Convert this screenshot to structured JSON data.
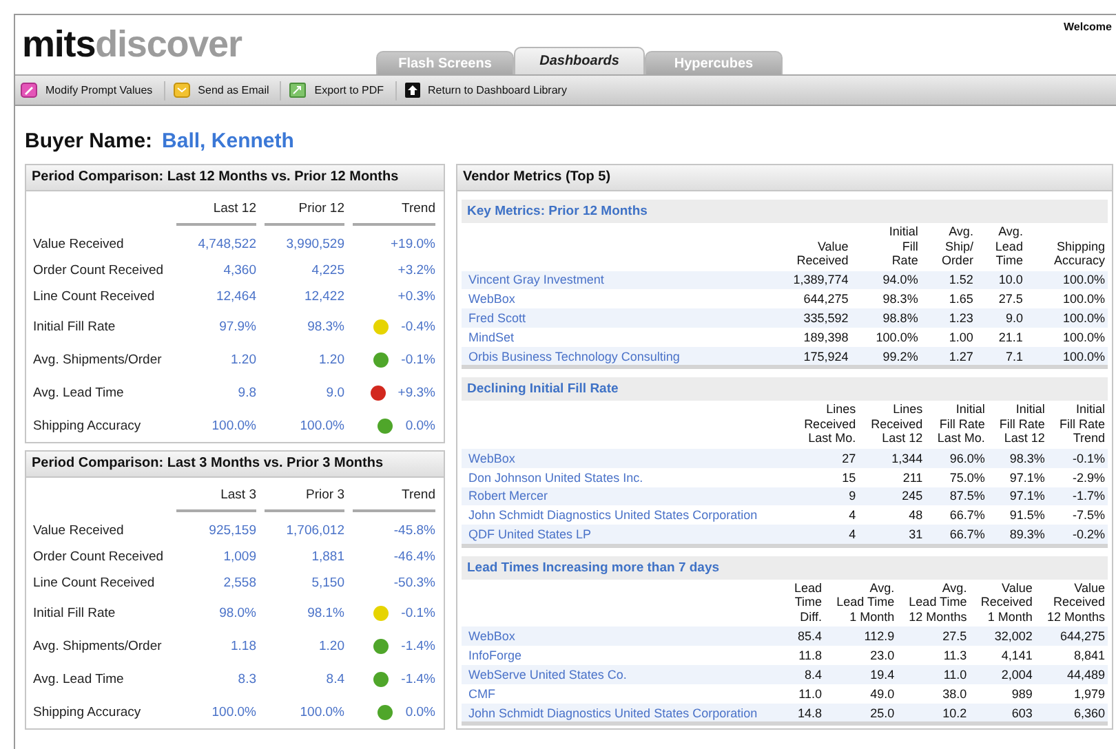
{
  "header": {
    "logo_dark": "mits",
    "logo_light": "discover",
    "welcome": "Welcome"
  },
  "tabs": [
    {
      "label": "Flash Screens",
      "selected": false
    },
    {
      "label": "Dashboards",
      "selected": true
    },
    {
      "label": "Hypercubes",
      "selected": false
    }
  ],
  "toolbar": [
    {
      "label": "Modify Prompt Values",
      "kind": "edit"
    },
    {
      "label": "Send as Email",
      "kind": "email"
    },
    {
      "label": "Export to PDF",
      "kind": "export"
    },
    {
      "label": "Return to Dashboard Library",
      "kind": "up"
    }
  ],
  "buyer": {
    "label": "Buyer Name:",
    "name": "Ball, Kenneth"
  },
  "period_panels": [
    {
      "title": "Period Comparison: Last 12 Months vs. Prior 12 Months",
      "columns": [
        "Last 12",
        "Prior 12",
        "Trend"
      ],
      "rows": [
        {
          "label": "Value Received",
          "current": "4,748,522",
          "prior": "3,990,529",
          "trend": "+19.0%"
        },
        {
          "label": "Order Count Received",
          "current": "4,360",
          "prior": "4,225",
          "trend": "+3.2%"
        },
        {
          "label": "Line Count Received",
          "current": "12,464",
          "prior": "12,422",
          "trend": "+0.3%"
        },
        {
          "label": "Initial Fill Rate",
          "current": "97.9%",
          "prior": "98.3%",
          "trend": "-0.4%",
          "color": "#e6d400"
        },
        {
          "label": "Avg. Shipments/Order",
          "current": "1.20",
          "prior": "1.20",
          "trend": "-0.1%",
          "color": "#4fa62a"
        },
        {
          "label": "Avg. Lead Time",
          "current": "9.8",
          "prior": "9.0",
          "trend": "+9.3%",
          "color": "#d2281e"
        },
        {
          "label": "Shipping Accuracy",
          "current": "100.0%",
          "prior": "100.0%",
          "trend": "0.0%",
          "color": "#4fa62a"
        }
      ]
    },
    {
      "title": "Period Comparison: Last 3 Months vs. Prior 3 Months",
      "columns": [
        "Last 3",
        "Prior 3",
        "Trend"
      ],
      "rows": [
        {
          "label": "Value Received",
          "current": "925,159",
          "prior": "1,706,012",
          "trend": "-45.8%"
        },
        {
          "label": "Order Count Received",
          "current": "1,009",
          "prior": "1,881",
          "trend": "-46.4%"
        },
        {
          "label": "Line Count Received",
          "current": "2,558",
          "prior": "5,150",
          "trend": "-50.3%"
        },
        {
          "label": "Initial Fill Rate",
          "current": "98.0%",
          "prior": "98.1%",
          "trend": "-0.1%",
          "color": "#e6d400"
        },
        {
          "label": "Avg. Shipments/Order",
          "current": "1.18",
          "prior": "1.20",
          "trend": "-1.4%",
          "color": "#4fa62a"
        },
        {
          "label": "Avg. Lead Time",
          "current": "8.3",
          "prior": "8.4",
          "trend": "-1.4%",
          "color": "#4fa62a"
        },
        {
          "label": "Shipping Accuracy",
          "current": "100.0%",
          "prior": "100.0%",
          "trend": "0.0%",
          "color": "#4fa62a"
        }
      ]
    }
  ],
  "vendor_panel": {
    "title": "Vendor Metrics (Top 5)",
    "sections": [
      {
        "title": "Key Metrics: Prior 12 Months",
        "columns": [
          "Value\nReceived",
          "Initial\nFill\nRate",
          "Avg.\nShip/\nOrder",
          "Avg.\nLead\nTime",
          "Shipping\nAccuracy"
        ],
        "rows": [
          {
            "name": "Vincent Gray Investment",
            "values": [
              "1,389,774",
              "94.0%",
              "1.52",
              "10.0",
              "100.0%"
            ]
          },
          {
            "name": "WebBox",
            "values": [
              "644,275",
              "98.3%",
              "1.65",
              "27.5",
              "100.0%"
            ]
          },
          {
            "name": "Fred Scott",
            "values": [
              "335,592",
              "98.8%",
              "1.23",
              "9.0",
              "100.0%"
            ]
          },
          {
            "name": "MindSet",
            "values": [
              "189,398",
              "100.0%",
              "1.00",
              "21.1",
              "100.0%"
            ]
          },
          {
            "name": "Orbis Business Technology Consulting",
            "values": [
              "175,924",
              "99.2%",
              "1.27",
              "7.1",
              "100.0%"
            ]
          }
        ]
      },
      {
        "title": "Declining Initial Fill Rate",
        "columns": [
          "Lines\nReceived\nLast Mo.",
          "Lines\nReceived\nLast 12",
          "Initial\nFill Rate\nLast Mo.",
          "Initial\nFill Rate\nLast 12",
          "Initial\nFill Rate\nTrend"
        ],
        "rows": [
          {
            "name": "WebBox",
            "values": [
              "27",
              "1,344",
              "96.0%",
              "98.3%",
              "-0.1%"
            ]
          },
          {
            "name": "Don Johnson United States Inc.",
            "values": [
              "15",
              "211",
              "75.0%",
              "97.1%",
              "-2.9%"
            ]
          },
          {
            "name": "Robert Mercer",
            "values": [
              "9",
              "245",
              "87.5%",
              "97.1%",
              "-1.7%"
            ]
          },
          {
            "name": "John Schmidt Diagnostics United States Corporation",
            "values": [
              "4",
              "48",
              "66.7%",
              "91.5%",
              "-7.5%"
            ]
          },
          {
            "name": "QDF United States LP",
            "values": [
              "4",
              "31",
              "66.7%",
              "89.3%",
              "-0.2%"
            ]
          }
        ]
      },
      {
        "title": "Lead Times Increasing more than 7 days",
        "columns": [
          "Lead\nTime\nDiff.",
          "Avg.\nLead Time\n1 Month",
          "Avg.\nLead Time\n12 Months",
          "Value\nReceived\n1 Month",
          "Value\nReceived\n12 Months"
        ],
        "rows": [
          {
            "name": "WebBox",
            "values": [
              "85.4",
              "112.9",
              "27.5",
              "32,002",
              "644,275"
            ]
          },
          {
            "name": "InfoForge",
            "values": [
              "11.8",
              "23.0",
              "11.3",
              "4,141",
              "8,841"
            ]
          },
          {
            "name": "WebServe United States Co.",
            "values": [
              "8.4",
              "19.4",
              "11.0",
              "2,004",
              "44,489"
            ]
          },
          {
            "name": "CMF",
            "values": [
              "11.0",
              "49.0",
              "38.0",
              "989",
              "1,979"
            ]
          },
          {
            "name": "John Schmidt Diagnostics United States Corporation",
            "values": [
              "14.8",
              "25.0",
              "10.2",
              "603",
              "6,360"
            ]
          }
        ]
      }
    ]
  }
}
